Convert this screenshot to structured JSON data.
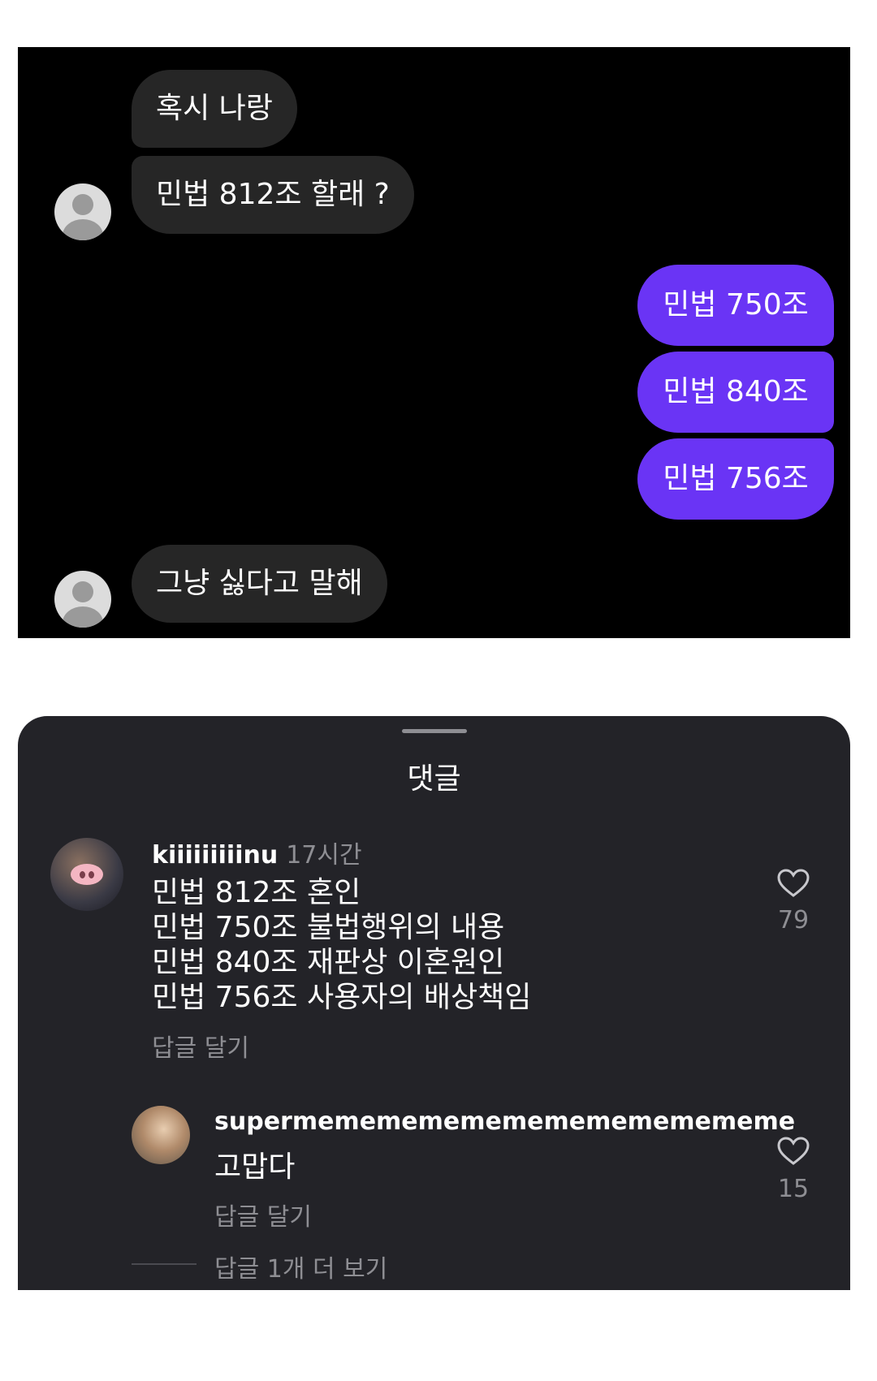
{
  "chat": {
    "messages": [
      {
        "from": "them",
        "text": "혹시 나랑"
      },
      {
        "from": "them",
        "text": "민법 812조 할래 ?"
      },
      {
        "from": "me",
        "text": "민법 750조"
      },
      {
        "from": "me",
        "text": "민법 840조"
      },
      {
        "from": "me",
        "text": "민법 756조"
      },
      {
        "from": "them",
        "text": "그냥 싫다고 말해"
      }
    ]
  },
  "comments": {
    "title": "댓글",
    "items": [
      {
        "username": "kiiiiiiiiinu",
        "time": "17시간",
        "lines": [
          "민법 812조 혼인",
          "민법 750조 불법행위의 내용",
          "민법 840조 재판상 이혼원인",
          "민법 756조 사용자의 배상책임"
        ],
        "reply_label": "답글 달기",
        "likes": "79"
      },
      {
        "username": "supermemememememememememememe",
        "text": "고맙다",
        "reply_label": "답글 달기",
        "likes": "15"
      }
    ],
    "more_replies": "답글 1개 더 보기"
  },
  "colors": {
    "outgoing_bubble": "#6a34f5",
    "incoming_bubble": "#262626",
    "sheet_bg": "#232328"
  }
}
